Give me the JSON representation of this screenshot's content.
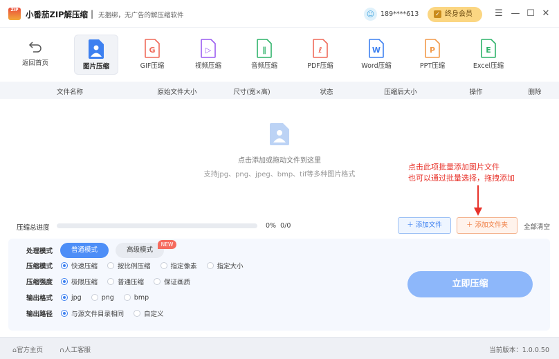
{
  "app": {
    "title": "小番茄ZIP解压缩",
    "slogan": "无捆绑，无广告的解压缩软件",
    "logo_text": "ZIP",
    "separator": "|",
    "user": "189****613",
    "vip_label": "终身会员"
  },
  "toolbar": {
    "back_label": "返回首页",
    "tools": [
      {
        "label": "图片压缩",
        "letter": "",
        "color": "#3d80f0"
      },
      {
        "label": "GIF压缩",
        "letter": "G",
        "color": "#ef6a5a"
      },
      {
        "label": "视频压缩",
        "letter": "▷",
        "color": "#9a5cf0"
      },
      {
        "label": "音频压缩",
        "letter": "∥",
        "color": "#2fb36a"
      },
      {
        "label": "PDF压缩",
        "letter": "ℓ",
        "color": "#ef6a5a"
      },
      {
        "label": "Word压缩",
        "letter": "W",
        "color": "#3d80f0"
      },
      {
        "label": "PPT压缩",
        "letter": "P",
        "color": "#f29a4a"
      },
      {
        "label": "Excel压缩",
        "letter": "E",
        "color": "#2fb36a"
      }
    ]
  },
  "table": {
    "columns": [
      "文件名称",
      "原始文件大小",
      "尺寸(宽×高)",
      "状态",
      "压缩后大小",
      "操作",
      "删除"
    ]
  },
  "empty": {
    "hint": "点击添加或拖动文件到这里",
    "formats": "支持jpg、png、jpeg、bmp、tif等多种图片格式"
  },
  "annotation": {
    "line1": "点击此项批量添加图片文件",
    "line2": "也可以通过批量选择，拖拽添加"
  },
  "progress": {
    "label": "压缩总进度",
    "percent": 0,
    "percent_text": "0%",
    "count": "0/0"
  },
  "actions": {
    "add_file": "＋ 添加文件",
    "add_folder": "＋ 添加文件夹",
    "clear_all": "全部清空"
  },
  "settings": {
    "mode_label": "处理模式",
    "mode_normal": "普通模式",
    "mode_advanced": "高级模式",
    "new_badge": "NEW",
    "rows": [
      {
        "label": "压缩模式",
        "options": [
          "快速压缩",
          "按比例压缩",
          "指定像素",
          "指定大小"
        ],
        "selected": 0
      },
      {
        "label": "压缩强度",
        "options": [
          "极限压缩",
          "普通压缩",
          "保证画质"
        ],
        "selected": 0
      },
      {
        "label": "输出格式",
        "options": [
          "jpg",
          "png",
          "bmp"
        ],
        "selected": 0
      },
      {
        "label": "输出路径",
        "options": [
          "与源文件目录相同",
          "自定义"
        ],
        "selected": 0
      }
    ],
    "go": "立即压缩"
  },
  "footer": {
    "home": "官方主页",
    "support": "人工客服",
    "version": "当前版本：1.0.0.50"
  }
}
